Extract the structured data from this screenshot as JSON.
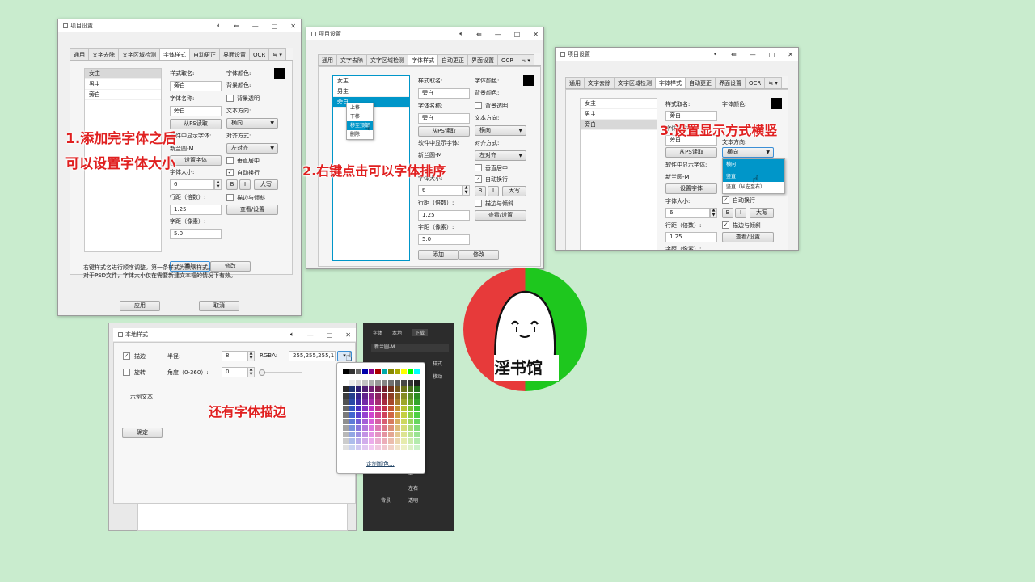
{
  "tabs": [
    "通用",
    "文字去除",
    "文字区域检测",
    "字体样式",
    "自动更正",
    "界面设置",
    "OCR"
  ],
  "tab_overflow": "≒ ▾",
  "win1": {
    "title": "项目设置",
    "list": [
      "女主",
      "男主",
      "旁白"
    ],
    "style_name_label": "样式取名:",
    "style_name": "旁白",
    "font_name_label": "字体名称:",
    "font_name": "旁白",
    "from_ps": "从PS读取",
    "display_font_label": "软件中显示字体:",
    "display_font": "新兰圆-M",
    "set_font": "设置字体",
    "font_size_label": "字体大小:",
    "font_size": "6",
    "line_spacing_label": "行距（倍数）:",
    "line_spacing": "1.25",
    "char_spacing_label": "字距（像素）:",
    "char_spacing": "5.0",
    "color_label": "字体颜色:",
    "bg_color_label": "背景颜色:",
    "bg_transparent": "背景透明",
    "direction_label": "文本方向:",
    "direction_value": "横向",
    "align_label": "对齐方式:",
    "align_value": "左对齐",
    "vcenter": "垂直居中",
    "auto_wrap": "自动换行",
    "bold": "B",
    "italic": "I",
    "upper": "大写",
    "stroke_italic": "描边与倾斜",
    "view_set": "查看/设置",
    "add": "添加",
    "modify": "修改",
    "note1": "右键样式名进行顺序调整。第一条样式为默认样式。",
    "note2": "对于PSD文件，字体大小仅在需要新建文本框的情况下有效。",
    "apply": "应用",
    "cancel": "取消"
  },
  "win2": {
    "title": "项目设置",
    "list": [
      "女主",
      "男主",
      "旁白"
    ],
    "context_menu": [
      "上移",
      "下移",
      "移至顶部",
      "删除"
    ]
  },
  "win3": {
    "title": "项目设置",
    "list": [
      "女主",
      "男主",
      "旁白"
    ],
    "direction_options": [
      "横向",
      "竖直",
      "竖直（从左至右）"
    ]
  },
  "win4": {
    "title": "本地样式",
    "stroke": "描边",
    "rotate": "旋转",
    "radius_label": "半径:",
    "radius": "8",
    "angle_label": "角度（0-360）:",
    "angle": "0",
    "rgba_label": "RGBA:",
    "rgba_value": "255,255,255,1",
    "sample": "示例文本",
    "ok": "确定",
    "custom_color": "定制颜色..."
  },
  "dark_panel": {
    "tabs": [
      "字体",
      "本地",
      "下载"
    ],
    "font": "新兰圆-M",
    "style": "样式",
    "move": "移动",
    "left_right": "左右",
    "up": "上",
    "bg": "背景",
    "opacity": "透明"
  },
  "annotations": {
    "a1_line1": "1.添加完字体之后",
    "a1_line2": "可以设置字体大小",
    "a2": "2.右键点击可以字体排序",
    "a3": "3.设置显示方式横竖",
    "a4": "还有字体描边"
  },
  "logo_text": "淫书馆",
  "colors": {
    "background": "#c9ecce",
    "accent": "#0096c9",
    "annotation": "#e02020",
    "logo_red": "#e73a3a",
    "logo_green": "#1ec71e"
  }
}
